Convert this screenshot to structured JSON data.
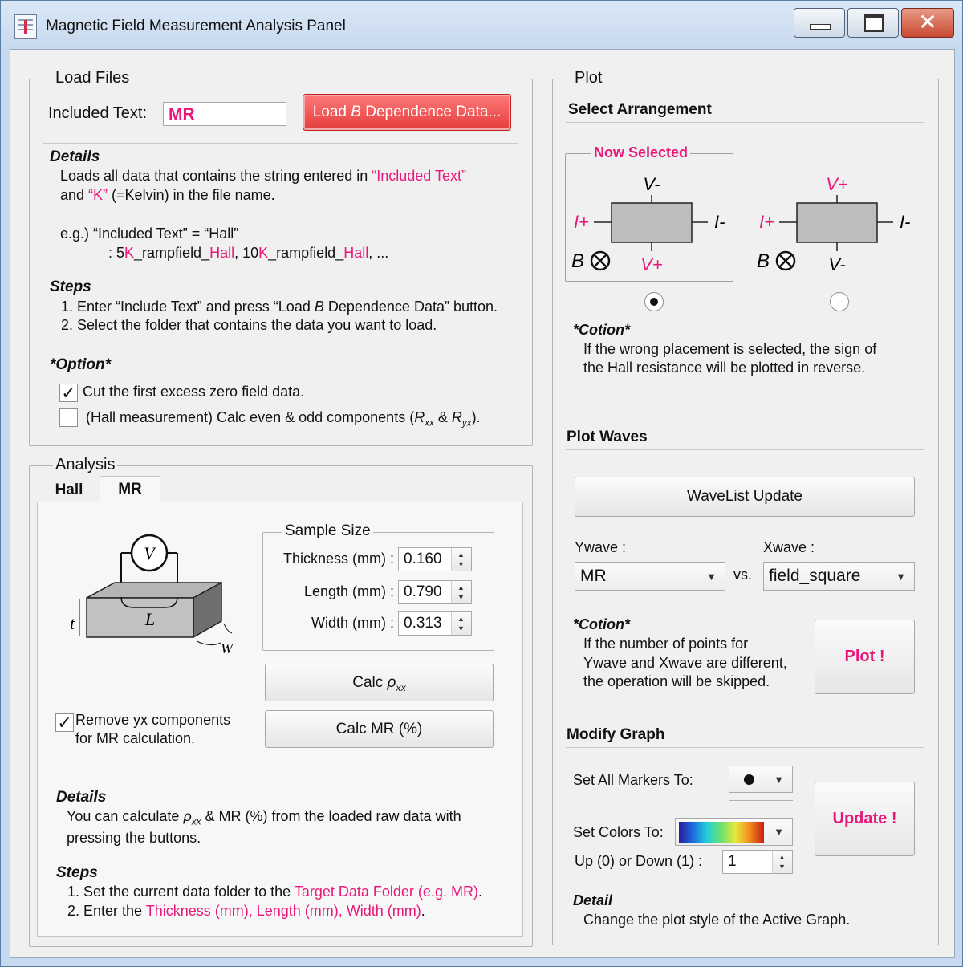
{
  "window": {
    "title": "Magnetic Field Measurement Analysis Panel"
  },
  "load_files": {
    "legend": "Load Files",
    "included_text_label": "Included Text:",
    "included_text_value": "MR",
    "load_button_pre": "Load ",
    "load_button_b": "B",
    "load_button_post": " Dependence Data...",
    "details_title": "Details",
    "details_line1_a": "Loads all data that contains the string entered in ",
    "details_line1_b": "“Included Text”",
    "details_line2_a": "and ",
    "details_line2_b": "“K”",
    "details_line2_c": " (=Kelvin) in the file name.",
    "eg_line": "e.g.) “Included Text” = “Hall”",
    "eg_files": [
      {
        "t": ": 5",
        "c": ""
      },
      {
        "t": "K",
        "c": "pink"
      },
      {
        "t": "_rampfield_",
        "c": ""
      },
      {
        "t": "Hall",
        "c": "pink"
      },
      {
        "t": ", 10",
        "c": ""
      },
      {
        "t": "K",
        "c": "pink"
      },
      {
        "t": "_rampfield_",
        "c": ""
      },
      {
        "t": "Hall",
        "c": "pink"
      },
      {
        "t": ", ...",
        "c": ""
      }
    ],
    "steps_title": "Steps",
    "step1_a": "1. Enter “Include Text” and press “Load ",
    "step1_b": "B",
    "step1_c": " Dependence Data” button.",
    "step2": "2. Select the folder that contains the data you want to load.",
    "option_title": "*Option*",
    "option1_label": "Cut the first excess zero field data.",
    "option1_checked": true,
    "option2_label_a": "(Hall measurement) Calc even & odd components (",
    "option2_label_b": ").",
    "option2_checked": false
  },
  "analysis": {
    "legend": "Analysis",
    "tabs": [
      "Hall",
      "MR"
    ],
    "active_tab": "MR",
    "diagram": {
      "v": "V",
      "l": "L",
      "t": "t",
      "w": "W"
    },
    "sample_size_legend": "Sample Size",
    "thickness_label": "Thickness (mm) :",
    "thickness_value": "0.160",
    "length_label": "Length (mm) :",
    "length_value": "0.790",
    "width_label": "Width (mm) :",
    "width_value": "0.313",
    "calc_rho_label": "Calc ",
    "calc_mr_label": "Calc MR (%)",
    "remove_yx_line1": "Remove yx components",
    "remove_yx_line2": "for MR calculation.",
    "remove_yx_checked": true,
    "details_title": "Details",
    "details_line1_a": "You can calculate ",
    "details_line1_b": " & MR (%) from the loaded raw data with",
    "details_line2": "pressing the buttons.",
    "steps_title": "Steps",
    "step1_a": "1. Set the current data folder to the ",
    "step1_b": "Target Data Folder (e.g. MR)",
    "step1_c": ".",
    "step2_a": "2.  Enter the ",
    "step2_b": "Thickness (mm), Length (mm), Width (mm)",
    "step2_c": "."
  },
  "plot": {
    "legend": "Plot",
    "select_arrangement": "Select Arrangement",
    "now_selected": "Now Selected",
    "arr1": {
      "top": "V-",
      "bottom": "V+",
      "left": "I+",
      "right": "I-",
      "b": "B",
      "selected": true
    },
    "arr2": {
      "top": "V+",
      "bottom": "V-",
      "left": "I+",
      "right": "I-",
      "b": "B",
      "selected": false
    },
    "caution_title": "*Cotion*",
    "caution_line1": "If the wrong placement is selected, the sign of",
    "caution_line2": "the Hall resistance will be plotted in reverse.",
    "plot_waves": "Plot Waves",
    "wavelist_update": "WaveList  Update",
    "ywave_label": "Ywave :",
    "xwave_label": "Xwave :",
    "ywave_value": "MR",
    "xwave_value": "field_square",
    "vs_label": "vs.",
    "caution2_title": "*Cotion*",
    "caution2_line1": "If the number of points for",
    "caution2_line2": "Ywave and Xwave are different,",
    "caution2_line3": "the operation will be skipped.",
    "plot_button": "Plot !",
    "modify_graph": "Modify Graph",
    "markers_label": "Set All Markers To:",
    "colors_label": "Set Colors To:",
    "updown_label": "Up (0) or Down (1) :",
    "updown_value": "1",
    "update_button": "Update !",
    "detail_title": "Detail",
    "detail_text": "Change the plot style of the Active Graph.",
    "accent_color": "#e8177a"
  }
}
